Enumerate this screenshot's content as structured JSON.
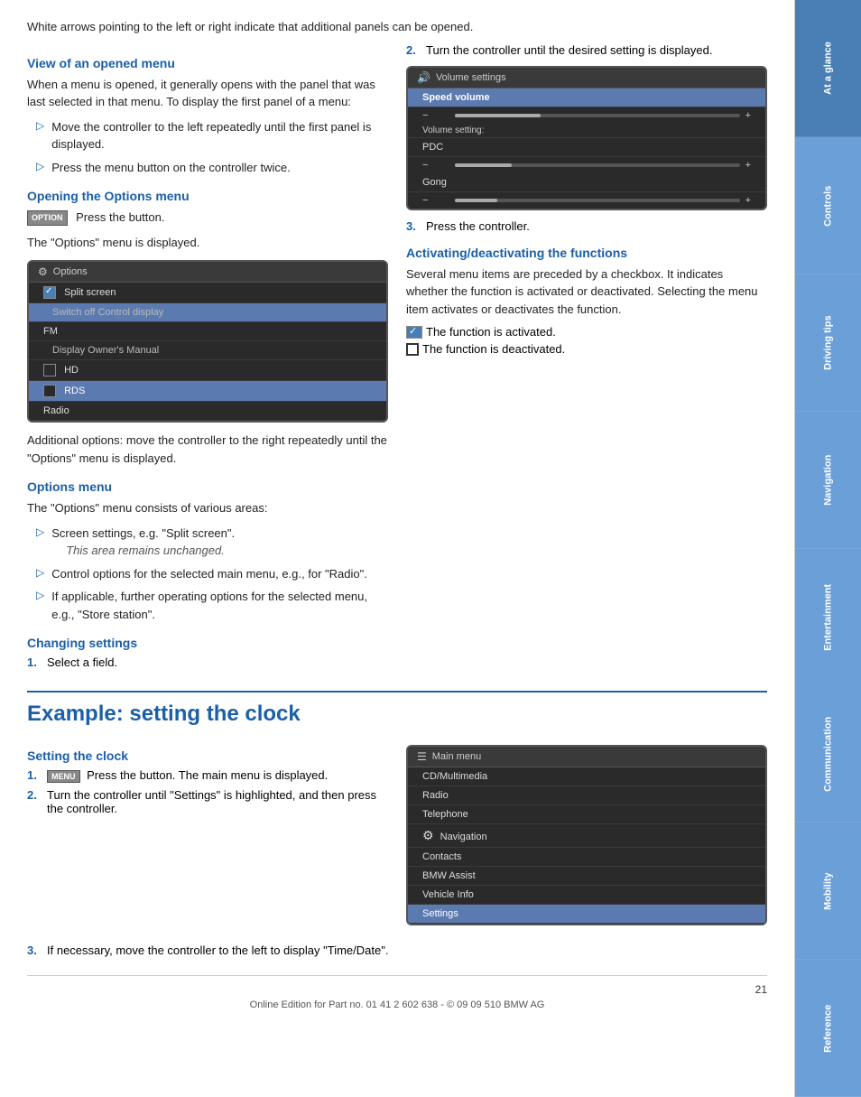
{
  "intro": {
    "para1": "White arrows pointing to the left or right indicate that additional panels can be opened."
  },
  "view_opened_menu": {
    "heading": "View of an opened menu",
    "para1": "When a menu is opened, it generally opens with the panel that was last selected in that menu. To display the first panel of a menu:",
    "bullets": [
      "Move the controller to the left repeatedly until the first panel is displayed.",
      "Press the menu button on the controller twice."
    ]
  },
  "opening_options": {
    "heading": "Opening the Options menu",
    "badge": "OPTION",
    "para1": "Press the button.",
    "para2": "The \"Options\" menu is displayed."
  },
  "options_panel": {
    "header_icon": "⚙",
    "header_label": "Options",
    "rows": [
      {
        "label": "Split screen",
        "type": "checked",
        "indent": false
      },
      {
        "label": "Switch off Control display",
        "type": "sub",
        "indent": true
      },
      {
        "label": "FM",
        "type": "plain",
        "indent": false
      },
      {
        "label": "Display Owner's Manual",
        "type": "sub",
        "indent": true
      },
      {
        "label": "HD",
        "type": "checkbox-unchecked",
        "indent": false
      },
      {
        "label": "RDS",
        "type": "checkbox-unchecked-selected",
        "indent": false
      },
      {
        "label": "Radio",
        "type": "plain",
        "indent": false
      }
    ]
  },
  "options_additional": {
    "para": "Additional options: move the controller to the right repeatedly until the \"Options\" menu is displayed."
  },
  "options_menu_section": {
    "heading": "Options menu",
    "para": "The \"Options\" menu consists of various areas:",
    "bullets": [
      {
        "text": "Screen settings, e.g. \"Split screen\".",
        "sub": "This area remains unchanged."
      },
      {
        "text": "Control options for the selected main menu, e.g., for \"Radio\".",
        "sub": null
      },
      {
        "text": "If applicable, further operating options for the selected menu, e.g., \"Store station\".",
        "sub": null
      }
    ]
  },
  "changing_settings": {
    "heading": "Changing settings",
    "step1": "Select a field."
  },
  "volume_panel": {
    "header_icon": "🔊",
    "header_label": "Volume settings",
    "speed_volume_label": "Speed volume",
    "slider_minus": "−",
    "slider_plus": "+",
    "volume_setting_label": "Volume setting:",
    "pdc_label": "PDC",
    "gong_label": "Gong"
  },
  "right_col": {
    "step2_label": "2.",
    "step2_text": "Turn the controller until the desired setting is displayed.",
    "step3_label": "3.",
    "step3_text": "Press the controller."
  },
  "activating": {
    "heading": "Activating/deactivating the functions",
    "para": "Several menu items are preceded by a checkbox. It indicates whether the function is activated or deactivated. Selecting the menu item activates or deactivates the function.",
    "active_label": "The function is activated.",
    "inactive_label": "The function is deactivated."
  },
  "example_clock": {
    "heading": "Example: setting the clock"
  },
  "setting_clock": {
    "heading": "Setting the clock",
    "badge": "MENU",
    "step1_num": "1.",
    "step1_text": "Press the button. The main menu is displayed.",
    "step2_num": "2.",
    "step2_text": "Turn the controller until \"Settings\" is highlighted, and then press the controller.",
    "step3_num": "3.",
    "step3_text": "If necessary, move the controller to the left to display \"Time/Date\"."
  },
  "main_menu_panel": {
    "header_icon": "☰",
    "header_label": "Main menu",
    "rows": [
      "CD/Multimedia",
      "Radio",
      "Telephone",
      "Navigation",
      "Contacts",
      "BMW Assist",
      "Vehicle Info",
      "Settings"
    ],
    "highlighted_row": "Settings"
  },
  "sidebar": {
    "tabs": [
      {
        "id": "at-glance",
        "label": "At a glance",
        "active": true
      },
      {
        "id": "controls",
        "label": "Controls",
        "active": false
      },
      {
        "id": "driving",
        "label": "Driving tips",
        "active": false
      },
      {
        "id": "navigation",
        "label": "Navigation",
        "active": false
      },
      {
        "id": "entertainment",
        "label": "Entertainment",
        "active": false
      },
      {
        "id": "communication",
        "label": "Communication",
        "active": false
      },
      {
        "id": "mobility",
        "label": "Mobility",
        "active": false
      },
      {
        "id": "reference",
        "label": "Reference",
        "active": false
      }
    ]
  },
  "footer": {
    "page_number": "21",
    "footer_text": "Online Edition for Part no. 01 41 2 602 638 - © 09 09 510 BMW AG"
  }
}
